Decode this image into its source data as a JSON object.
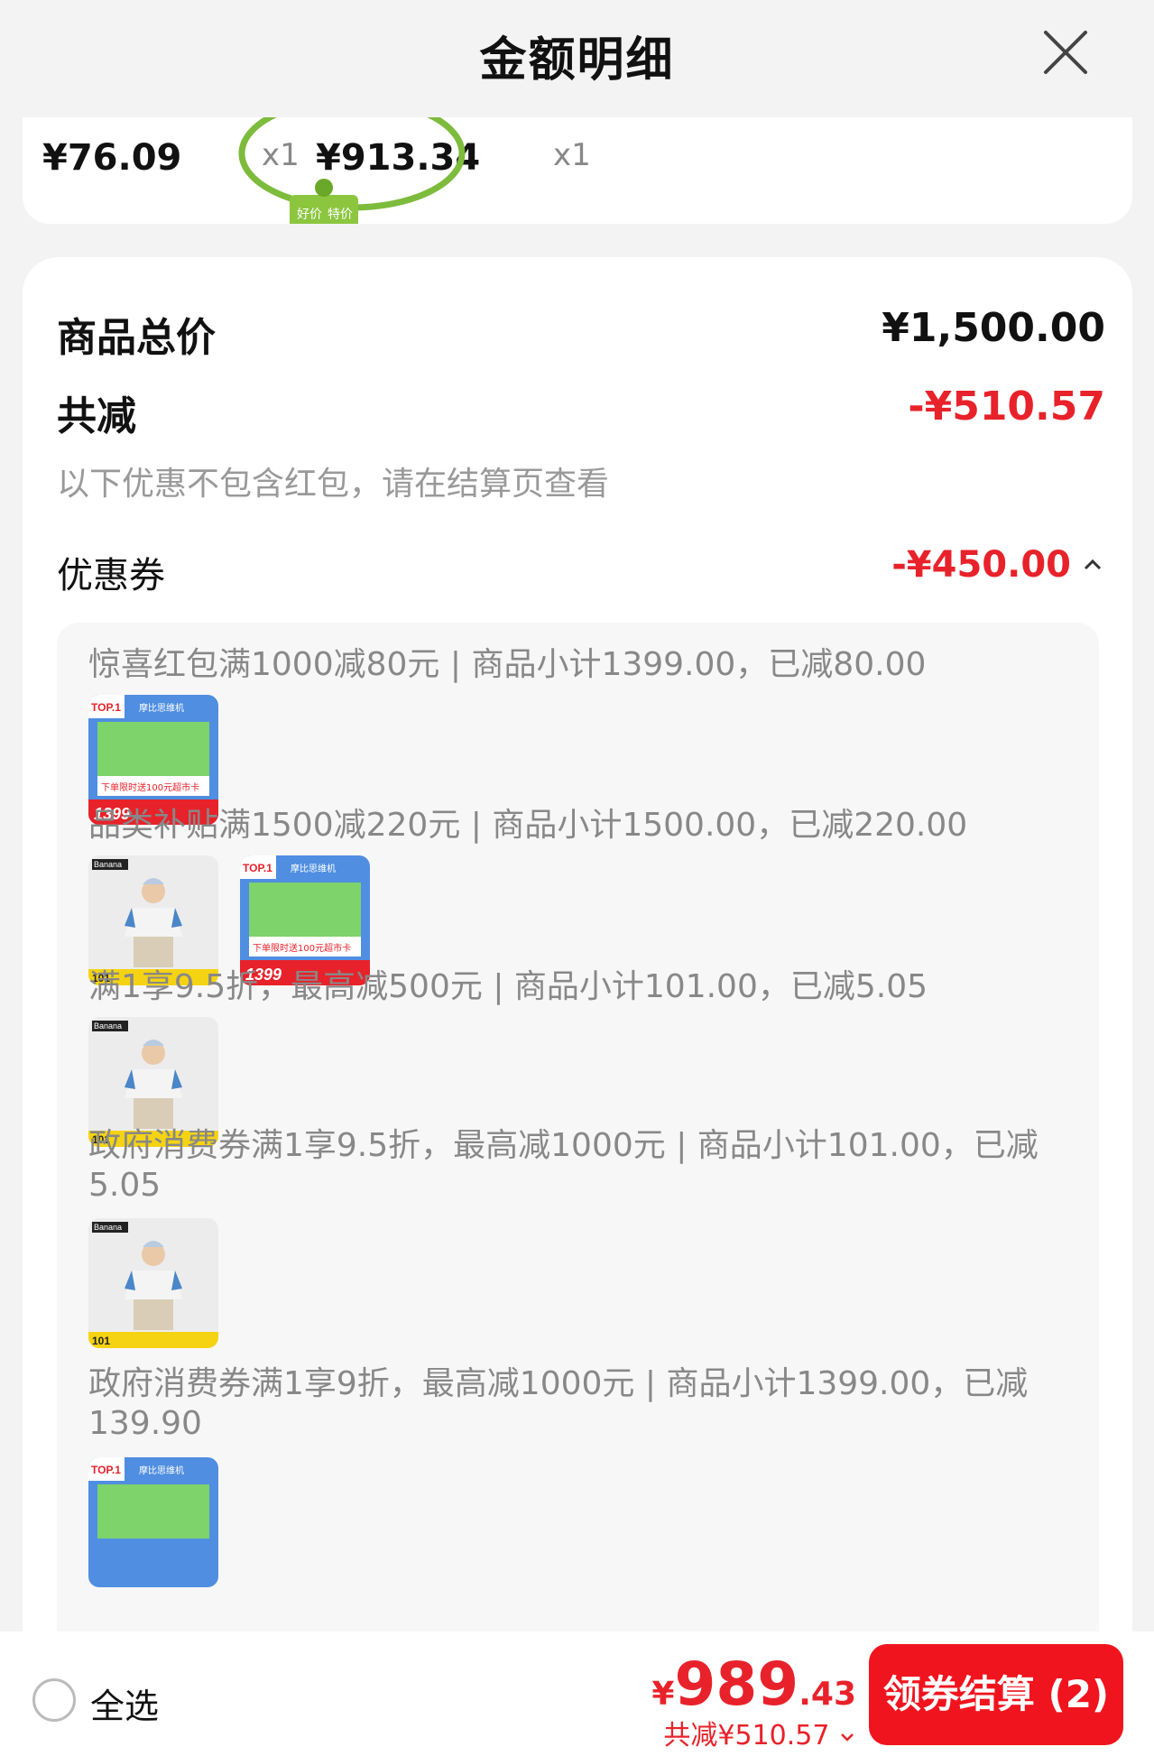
{
  "header": {
    "title": "金额明细"
  },
  "products": [
    {
      "strip_label": "101",
      "price": "¥76.09",
      "qty": "x1"
    },
    {
      "strip_label": "1399",
      "price": "¥913.34",
      "qty": "x1",
      "badge": [
        "好价",
        "特价"
      ]
    }
  ],
  "summary": {
    "total_label": "商品总价",
    "total_value": "¥1,500.00",
    "reduce_label": "共减",
    "reduce_value": "-¥510.57",
    "note": "以下优惠不包含红包，请在结算页查看",
    "coupon_label": "优惠券",
    "coupon_value": "-¥450.00"
  },
  "coupons": [
    {
      "text": "惊喜红包满1000减80元 | 商品小计1399.00，已减80.00",
      "thumbs": [
        "console"
      ]
    },
    {
      "text": "品类补贴满1500减220元 | 商品小计1500.00，已减220.00",
      "thumbs": [
        "shirt",
        "console"
      ]
    },
    {
      "text": "满1享9.5折，最高减500元 | 商品小计101.00，已减5.05",
      "thumbs": [
        "shirt"
      ]
    },
    {
      "text": "政府消费券满1享9.5折，最高减1000元 | 商品小计101.00，已减5.05",
      "thumbs": [
        "shirt"
      ]
    },
    {
      "text": "政府消费券满1享9折，最高减1000元 | 商品小计1399.00，已减139.90",
      "thumbs": [
        "console"
      ]
    }
  ],
  "footer": {
    "select_all": "全选",
    "yen": "¥",
    "total_int": "989",
    "total_dec": ".43",
    "saved": "共减¥510.57",
    "checkout": "领券结算 (2)"
  },
  "thumb_texts": {
    "console_price": "1399",
    "console_brand": "摩比思维机",
    "console_promo": "下单限时送100元超市卡",
    "console_top": "TOP.1",
    "shirt_brand": "Banana",
    "shirt_price": "101"
  },
  "colors": {
    "accent": "#e8222a",
    "checkout": "#f0141e",
    "circle": "#7dbb3c"
  },
  "icons": [
    "close-icon",
    "chevron-up-icon",
    "chevron-down-icon",
    "radio-circle-icon"
  ]
}
